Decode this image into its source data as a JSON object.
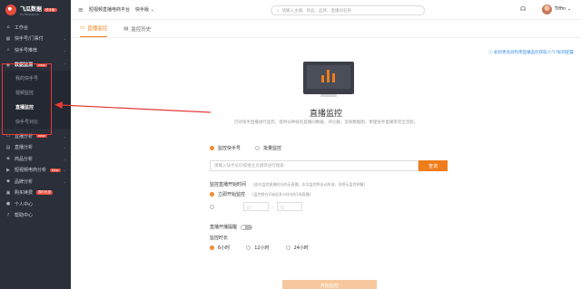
{
  "brand": {
    "name": "飞瓜数据",
    "badge": "快手版",
    "domain": "ks.feigua.cn"
  },
  "topbar": {
    "platform": "短视频直播电商平台",
    "platform_select": "快手版",
    "search_placeholder": "请输入主播、商品、品牌、直播间名称",
    "username": "Tiffin"
  },
  "sidebar": {
    "items": [
      {
        "label": "工作台",
        "icon": "home-icon"
      },
      {
        "label": "快手号/门事付",
        "icon": "grid-icon"
      },
      {
        "label": "快手号推荐",
        "icon": "search-icon"
      }
    ],
    "group": {
      "label": "数据监测",
      "tag": "New",
      "icon": "eye-icon"
    },
    "sub_items": [
      {
        "label": "我的快手号"
      },
      {
        "label": "视频监控"
      },
      {
        "label": "直播监控",
        "active": true
      },
      {
        "label": "快手号对比"
      }
    ],
    "more": [
      {
        "label": "直播分析",
        "tag": "New",
        "icon": "tv-icon"
      },
      {
        "label": "直播分析",
        "tag": "",
        "icon": "chart-icon"
      },
      {
        "label": "商品分析",
        "tag": "",
        "icon": "bag-icon"
      },
      {
        "label": "短视频电商分析",
        "tag": "New",
        "icon": "video-icon"
      },
      {
        "label": "品牌分析",
        "tag": "",
        "icon": "tag-icon"
      },
      {
        "label": "购买续费",
        "tag": "限时优惠",
        "icon": "cart-icon"
      },
      {
        "label": "个人中心",
        "tag": "",
        "icon": "user-icon"
      },
      {
        "label": "帮助中心",
        "tag": "",
        "icon": "help-icon"
      }
    ]
  },
  "tabs": [
    {
      "label": "直播监控",
      "active": true
    },
    {
      "label": "监控历史",
      "active": false
    }
  ],
  "help_link": "如何更高效利用直播监控获取人气?如何配置",
  "page": {
    "title": "直播监控",
    "subtitle": "可对快手直播进行监控，提供分钟级的直播间数据、评论截、流商数据图、更理快手直播带货全流程。"
  },
  "form": {
    "opt_account": "监控快手号",
    "opt_batch": "批量监控",
    "input_placeholder": "请输入快手号ID或搜主页跳转进行搜索",
    "query_btn": "查询",
    "time_label": "监控直播开始时间",
    "time_hint": "(若在监控直播时间内无直播，本次监控将自动失效，但将无监控预算)",
    "immediate": "立即开始监控",
    "immediate_hint": "(监控将在开始后8小时内的1场直播)",
    "date_placeholder": "",
    "remind_label": "直播开播提醒",
    "duration_label": "监控时长",
    "durations": [
      "6小时",
      "12小时",
      "24小时"
    ],
    "start_btn": "开始监控"
  },
  "colors": {
    "accent": "#f07d1b",
    "sidebar": "#2b2f3a",
    "annotation": "#e53935"
  }
}
